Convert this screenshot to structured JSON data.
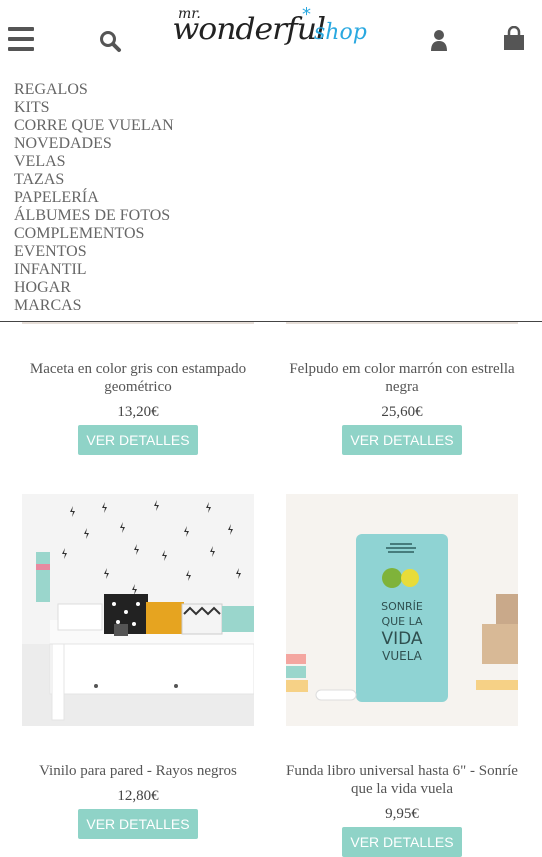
{
  "header": {
    "logo_text": "mr. wonderful* shop",
    "logo_mr": "mr.",
    "logo_main": "wonderful",
    "logo_shop": "shop"
  },
  "menu": {
    "items": [
      "REGALOS",
      "KITS",
      "CORRE QUE VUELAN",
      "NOVEDADES",
      "VELAS",
      "TAZAS",
      "PAPELERÍA",
      "ÁLBUMES DE FOTOS",
      "COMPLEMENTOS",
      "EVENTOS",
      "INFANTIL",
      "HOGAR",
      "MARCAS"
    ]
  },
  "products": [
    {
      "title": "Maceta en color gris con estampado geométrico",
      "price": "13,20€",
      "button": "VER DETALLES"
    },
    {
      "title": "Felpudo em color marrón con estrella negra",
      "price": "25,60€",
      "button": "VER DETALLES"
    },
    {
      "title": "Vinilo para pared - Rayos negros",
      "price": "12,80€",
      "button": "VER DETALLES"
    },
    {
      "title": "Funda libro universal hasta 6\" - Sonríe que la vida vuela",
      "price": "9,95€",
      "button": "VER DETALLES"
    }
  ],
  "book_cover_text": [
    "SONRÍE",
    "QUE LA",
    "VIDA",
    "VUELA"
  ],
  "colors": {
    "accent": "#29a8e0",
    "button": "#8fd3c7",
    "book": "#8fd3d3"
  }
}
